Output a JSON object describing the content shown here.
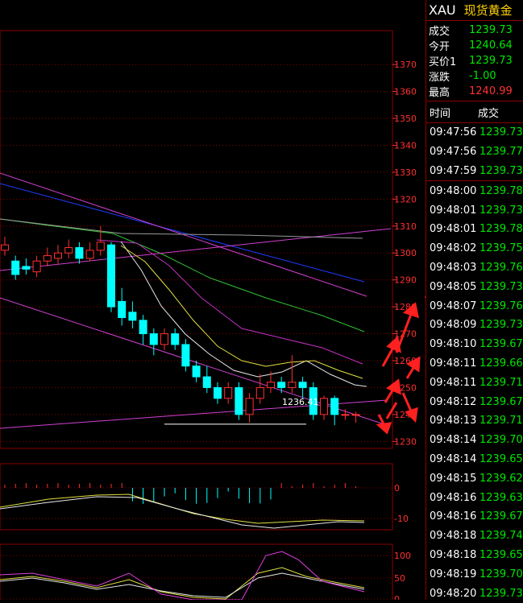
{
  "quote": {
    "symbol": "XAU",
    "name": "现货黄金",
    "rows": [
      {
        "label": "成交",
        "value": "1239.73",
        "color": "#00e600"
      },
      {
        "label": "今开",
        "value": "1240.64",
        "color": "#00e600"
      },
      {
        "label": "买价1",
        "value": "1239.73",
        "color": "#00e600"
      },
      {
        "label": "涨跌",
        "value": "-1.00",
        "color": "#00e600"
      },
      {
        "label": "最高",
        "value": "1240.99",
        "color": "#ff3030"
      }
    ]
  },
  "ticks": {
    "headers": [
      "时间",
      "成交"
    ],
    "rows": [
      {
        "time": "09:47:56",
        "price": "1239.73"
      },
      {
        "time": "09:47:56",
        "price": "1239.77"
      },
      {
        "time": "09:47:59",
        "price": "1239.73"
      },
      {
        "time": "09:48:00",
        "price": "1239.78"
      },
      {
        "time": "09:48:01",
        "price": "1239.73"
      },
      {
        "time": "09:48:01",
        "price": "1239.78"
      },
      {
        "time": "09:48:02",
        "price": "1239.75"
      },
      {
        "time": "09:48:03",
        "price": "1239.76"
      },
      {
        "time": "09:48:05",
        "price": "1239.73"
      },
      {
        "time": "09:48:07",
        "price": "1239.76"
      },
      {
        "time": "09:48:09",
        "price": "1239.73"
      },
      {
        "time": "09:48:10",
        "price": "1239.67"
      },
      {
        "time": "09:48:11",
        "price": "1239.66"
      },
      {
        "time": "09:48:11",
        "price": "1239.71"
      },
      {
        "time": "09:48:12",
        "price": "1239.67"
      },
      {
        "time": "09:48:13",
        "price": "1239.71"
      },
      {
        "time": "09:48:14",
        "price": "1239.70"
      },
      {
        "time": "09:48:14",
        "price": "1239.65"
      },
      {
        "time": "09:48:15",
        "price": "1239.62"
      },
      {
        "time": "09:48:16",
        "price": "1239.63"
      },
      {
        "time": "09:48:16",
        "price": "1239.67"
      },
      {
        "time": "09:48:18",
        "price": "1239.74"
      },
      {
        "time": "09:48:18",
        "price": "1239.65"
      },
      {
        "time": "09:48:19",
        "price": "1239.70"
      },
      {
        "time": "09:48:20",
        "price": "1239.73"
      }
    ]
  },
  "chart_data": {
    "type": "candlestick",
    "main": {
      "y_ticks": [
        1370,
        1360,
        1350,
        1340,
        1330,
        1320,
        1310,
        1300,
        1290,
        1280,
        1270,
        1260,
        1250,
        1240,
        1230
      ],
      "ylim": [
        1228,
        1382
      ],
      "annotation": {
        "text": "1236.41",
        "index": 15,
        "value": 1236.41
      },
      "candles": [
        {
          "o": 1301,
          "c": 1303,
          "h": 1306,
          "l": 1299
        },
        {
          "o": 1297,
          "c": 1292,
          "h": 1299,
          "l": 1290
        },
        {
          "o": 1295,
          "c": 1294,
          "h": 1298,
          "l": 1292
        },
        {
          "o": 1293,
          "c": 1297,
          "h": 1299,
          "l": 1291
        },
        {
          "o": 1297,
          "c": 1299,
          "h": 1302,
          "l": 1295
        },
        {
          "o": 1298,
          "c": 1300,
          "h": 1303,
          "l": 1296
        },
        {
          "o": 1300,
          "c": 1302,
          "h": 1305,
          "l": 1298
        },
        {
          "o": 1302,
          "c": 1298,
          "h": 1304,
          "l": 1296
        },
        {
          "o": 1298,
          "c": 1301,
          "h": 1304,
          "l": 1297
        },
        {
          "o": 1301,
          "c": 1304,
          "h": 1310,
          "l": 1299
        },
        {
          "o": 1303,
          "c": 1280,
          "h": 1304,
          "l": 1278
        },
        {
          "o": 1282,
          "c": 1276,
          "h": 1287,
          "l": 1273
        },
        {
          "o": 1278,
          "c": 1275,
          "h": 1282,
          "l": 1272
        },
        {
          "o": 1275,
          "c": 1270,
          "h": 1277,
          "l": 1266
        },
        {
          "o": 1270,
          "c": 1266,
          "h": 1272,
          "l": 1262
        },
        {
          "o": 1266,
          "c": 1270,
          "h": 1272,
          "l": 1264
        },
        {
          "o": 1270,
          "c": 1266,
          "h": 1272,
          "l": 1264
        },
        {
          "o": 1266,
          "c": 1258,
          "h": 1268,
          "l": 1256
        },
        {
          "o": 1258,
          "c": 1254,
          "h": 1260,
          "l": 1252
        },
        {
          "o": 1254,
          "c": 1250,
          "h": 1258,
          "l": 1248
        },
        {
          "o": 1250,
          "c": 1246,
          "h": 1252,
          "l": 1244
        },
        {
          "o": 1246,
          "c": 1250,
          "h": 1252,
          "l": 1244
        },
        {
          "o": 1250,
          "c": 1240,
          "h": 1252,
          "l": 1238
        },
        {
          "o": 1240,
          "c": 1246,
          "h": 1248,
          "l": 1237
        },
        {
          "o": 1246,
          "c": 1250,
          "h": 1255,
          "l": 1244
        },
        {
          "o": 1250,
          "c": 1252,
          "h": 1256,
          "l": 1248
        },
        {
          "o": 1252,
          "c": 1250,
          "h": 1254,
          "l": 1248
        },
        {
          "o": 1250,
          "c": 1252,
          "h": 1262,
          "l": 1248
        },
        {
          "o": 1252,
          "c": 1250,
          "h": 1254,
          "l": 1246
        },
        {
          "o": 1250,
          "c": 1240,
          "h": 1252,
          "l": 1238
        },
        {
          "o": 1240,
          "c": 1246,
          "h": 1247,
          "l": 1238
        },
        {
          "o": 1246,
          "c": 1240,
          "h": 1247,
          "l": 1236
        },
        {
          "o": 1240,
          "c": 1240,
          "h": 1242,
          "l": 1238
        },
        {
          "o": 1240,
          "c": 1240,
          "h": 1241,
          "l": 1237
        }
      ]
    },
    "macd": {
      "y_ticks": [
        0,
        -10
      ]
    },
    "kdj": {
      "y_ticks": [
        100,
        50,
        0
      ]
    }
  },
  "colors": {
    "up": "#ff3030",
    "down": "#00ffff",
    "grid": "#8b0000",
    "axis": "#ff3030"
  }
}
